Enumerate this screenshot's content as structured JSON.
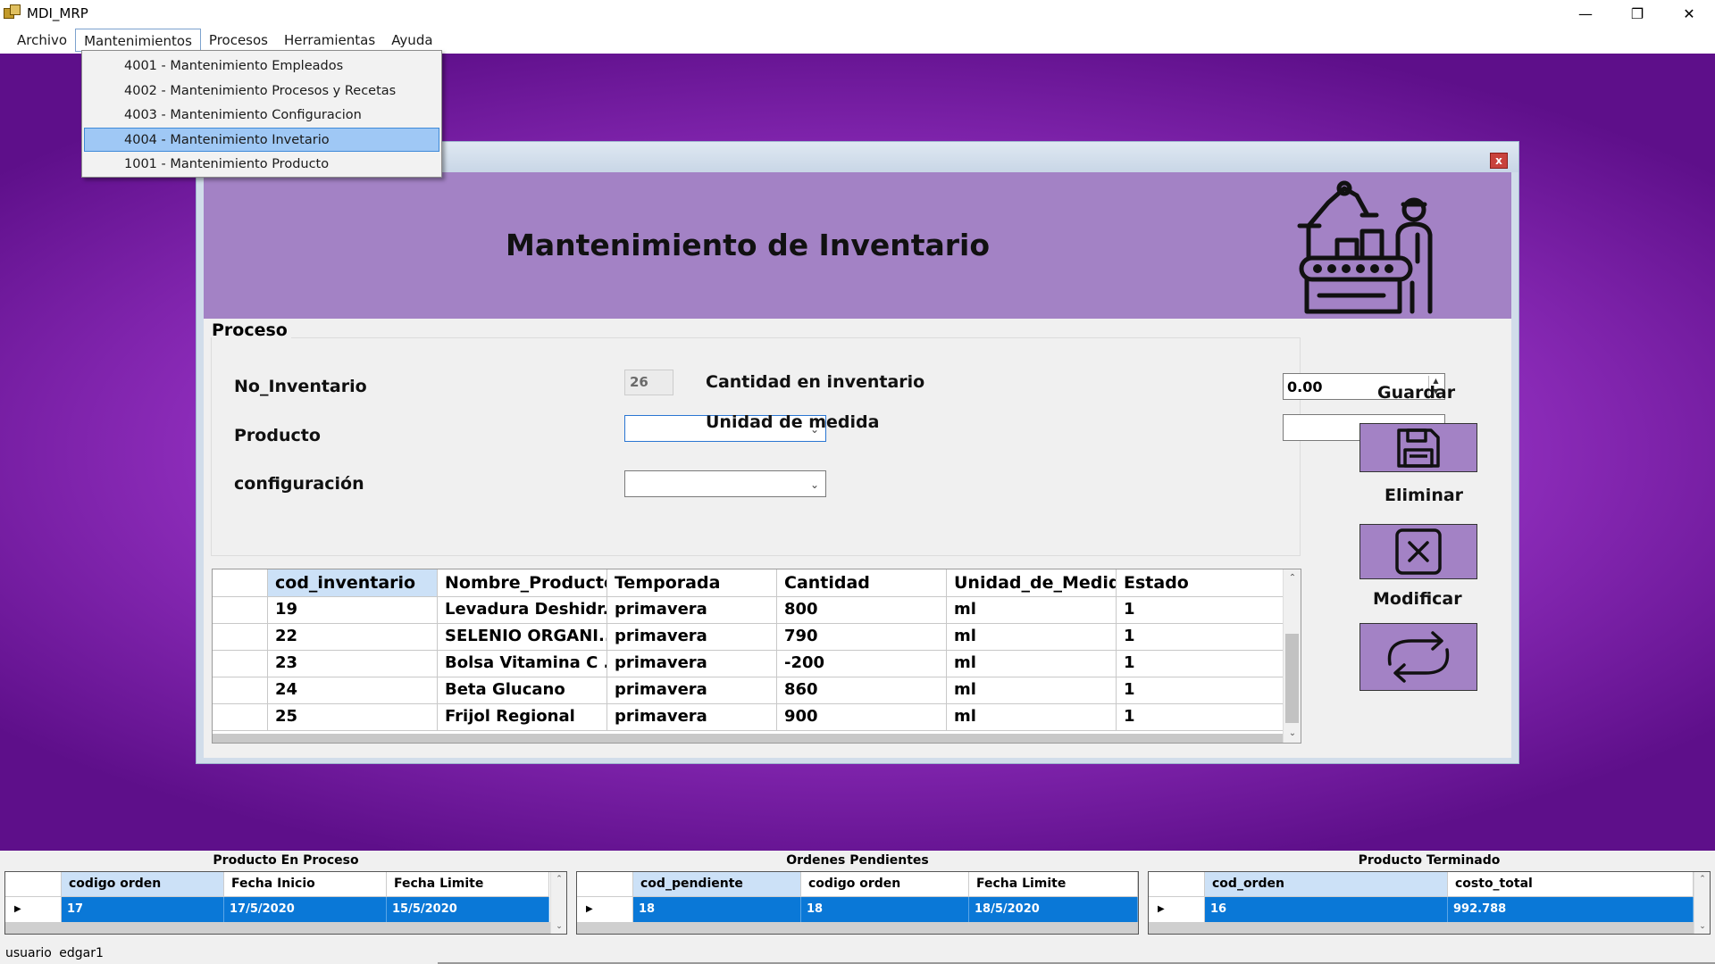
{
  "window": {
    "title": "MDI_MRP",
    "minimize": "—",
    "maximize": "❐",
    "close": "✕"
  },
  "menu": {
    "items": [
      "Archivo",
      "Mantenimientos",
      "Procesos",
      "Herramientas",
      "Ayuda"
    ],
    "open": "Mantenimientos",
    "dropdown": [
      "4001 - Mantenimiento Empleados",
      "4002 - Mantenimiento Procesos y Recetas",
      "4003 - Mantenimiento Configuracion",
      "4004 - Mantenimiento Invetario",
      "1001 - Mantenimiento Producto"
    ],
    "highlighted_index": 3
  },
  "form": {
    "close_label": "x",
    "title": "Mantenimiento de Inventario",
    "group_label": "Proceso",
    "no_inventario_label": "No_Inventario",
    "no_inventario_value": "26",
    "producto_label": "Producto",
    "configuracion_label": "configuración",
    "cantidad_label": "Cantidad en inventario",
    "cantidad_value": "0.00",
    "unidad_label": "Unidad de medida",
    "producto_value": "",
    "configuracion_value": "",
    "unidad_value": "",
    "buttons": {
      "guardar": "Guardar",
      "eliminar": "Eliminar",
      "modificar": "Modificar"
    },
    "accent_color": "#a382c5"
  },
  "grid": {
    "columns": [
      "cod_inventario",
      "Nombre_Producto",
      "Temporada",
      "Cantidad",
      "Unidad_de_Medida",
      "Estado"
    ],
    "column_labels": [
      "cod_inventario",
      "Nombre_Producto",
      "Temporada",
      "Cantidad",
      "Unidad_de_Medidс",
      "Estado"
    ],
    "rows": [
      [
        "19",
        "Levadura Deshidr...",
        "primavera",
        "800",
        "ml",
        "1"
      ],
      [
        "22",
        "SELENIO ORGANI...",
        "primavera",
        "790",
        "ml",
        "1"
      ],
      [
        "23",
        "Bolsa Vitamina C ...",
        "primavera",
        "-200",
        "ml",
        "1"
      ],
      [
        "24",
        "Beta Glucano",
        "primavera",
        "860",
        "ml",
        "1"
      ],
      [
        "25",
        "Frijol Regional",
        "primavera",
        "900",
        "ml",
        "1"
      ]
    ]
  },
  "panels": {
    "en_proceso": {
      "title": "Producto En Proceso",
      "columns": [
        "codigo orden",
        "Fecha Inicio",
        "Fecha Limite"
      ],
      "row": [
        "17",
        "17/5/2020",
        "15/5/2020"
      ]
    },
    "pendientes": {
      "title": "Ordenes Pendientes",
      "columns": [
        "cod_pendiente",
        "codigo orden",
        "Fecha Limite"
      ],
      "row": [
        "18",
        "18",
        "18/5/2020"
      ]
    },
    "terminado": {
      "title": "Producto Terminado",
      "columns": [
        "cod_orden",
        "costo_total"
      ],
      "row": [
        "16",
        "992.788"
      ]
    }
  },
  "status": {
    "label": "usuario",
    "user": "edgar1"
  },
  "colors": {
    "selection": "#0a78d7",
    "header_selected": "#cce1f7",
    "mdi_purple": "#8b2bb8"
  }
}
